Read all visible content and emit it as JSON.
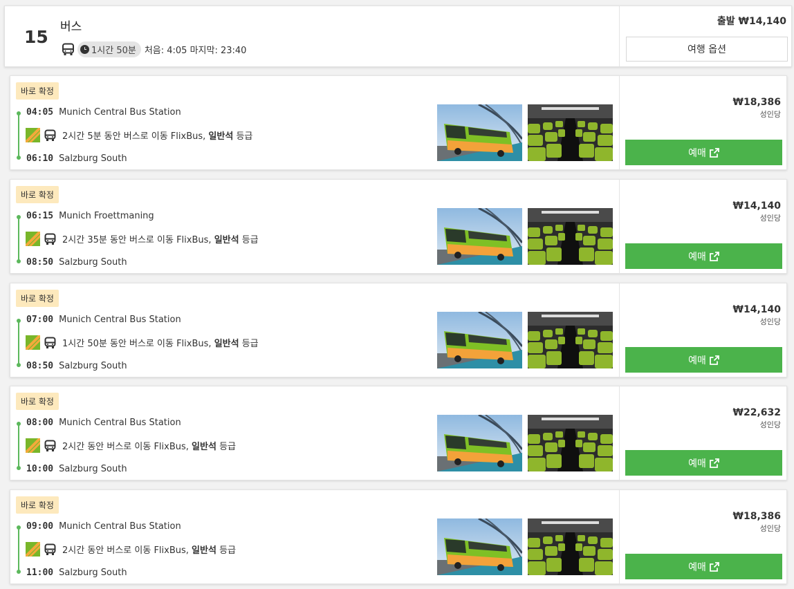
{
  "header": {
    "route_number": "15",
    "route_type": "버스",
    "duration": "1시간 50분",
    "schedule": "처음: 4:05 마지막: 23:40",
    "depart_price": "출발 ₩14,140",
    "options_label": "여행 옵션"
  },
  "trips": [
    {
      "badge": "바로 확정",
      "dep_time": "04:05",
      "dep_station": "Munich Central Bus Station",
      "segment_text": "2시간 5분 동안 버스로 이동 FlixBus,",
      "class_label": "일반석",
      "class_suffix": "등급",
      "arr_time": "06:10",
      "arr_station": "Salzburg South",
      "price": "₩18,386",
      "per_person": "성인당",
      "book_label": "예매"
    },
    {
      "badge": "바로 확정",
      "dep_time": "06:15",
      "dep_station": "Munich Froettmaning",
      "segment_text": "2시간 35분 동안 버스로 이동 FlixBus,",
      "class_label": "일반석",
      "class_suffix": "등급",
      "arr_time": "08:50",
      "arr_station": "Salzburg South",
      "price": "₩14,140",
      "per_person": "성인당",
      "book_label": "예매"
    },
    {
      "badge": "바로 확정",
      "dep_time": "07:00",
      "dep_station": "Munich Central Bus Station",
      "segment_text": "1시간 50분 동안 버스로 이동 FlixBus,",
      "class_label": "일반석",
      "class_suffix": "등급",
      "arr_time": "08:50",
      "arr_station": "Salzburg South",
      "price": "₩14,140",
      "per_person": "성인당",
      "book_label": "예매"
    },
    {
      "badge": "바로 확정",
      "dep_time": "08:00",
      "dep_station": "Munich Central Bus Station",
      "segment_text": "2시간 동안 버스로 이동 FlixBus,",
      "class_label": "일반석",
      "class_suffix": "등급",
      "arr_time": "10:00",
      "arr_station": "Salzburg South",
      "price": "₩22,632",
      "per_person": "성인당",
      "book_label": "예매"
    },
    {
      "badge": "바로 확정",
      "dep_time": "09:00",
      "dep_station": "Munich Central Bus Station",
      "segment_text": "2시간 동안 버스로 이동 FlixBus,",
      "class_label": "일반석",
      "class_suffix": "등급",
      "arr_time": "11:00",
      "arr_station": "Salzburg South",
      "price": "₩18,386",
      "per_person": "성인당",
      "book_label": "예매"
    }
  ],
  "icons": {
    "bus": "bus-icon",
    "clock": "clock-icon",
    "operator": "flixbus-logo-icon",
    "external": "external-link-icon"
  },
  "colors": {
    "accent_green": "#4bb34b",
    "timeline_green": "#5cb85c",
    "badge_bg": "#fde9bd",
    "flixbus_green": "#79b62a",
    "flixbus_orange": "#f4a93b"
  }
}
